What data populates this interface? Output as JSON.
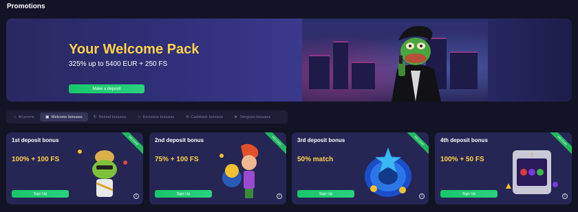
{
  "page": {
    "title": "Promotions"
  },
  "hero": {
    "title": "Your Welcome Pack",
    "subtitle": "325% up to 5400 EUR + 250 FS",
    "button_label": "Make a deposit"
  },
  "tabs": [
    {
      "label": "All promo",
      "icon": "gift-outline-icon",
      "active": false
    },
    {
      "label": "Welcome bonuses",
      "icon": "gift-icon",
      "active": true
    },
    {
      "label": "Reload bonuses",
      "icon": "reload-icon",
      "active": false
    },
    {
      "label": "Exclusive bonuses",
      "icon": "star-icon",
      "active": false
    },
    {
      "label": "Cashback bonuses",
      "icon": "cashback-icon",
      "active": false
    },
    {
      "label": "Telegram bonuses",
      "icon": "telegram-icon",
      "active": false
    }
  ],
  "cards": [
    {
      "title": "1st deposit bonus",
      "offer": "100% + 100 FS",
      "button_label": "Sign Up",
      "ribbon": "WELCOME"
    },
    {
      "title": "2nd deposit bonus",
      "offer": "75% + 100 FS",
      "button_label": "Sign Up",
      "ribbon": "WELCOME"
    },
    {
      "title": "3rd deposit bonus",
      "offer": "50% match",
      "button_label": "Sign Up",
      "ribbon": "WELCOME"
    },
    {
      "title": "4th deposit bonus",
      "offer": "100% + 50 FS",
      "button_label": "Sign Up",
      "ribbon": "WELCOME"
    }
  ],
  "colors": {
    "background": "#131326",
    "card": "#262654",
    "accent_yellow": "#ffd24a",
    "accent_green": "#1fc46e"
  }
}
